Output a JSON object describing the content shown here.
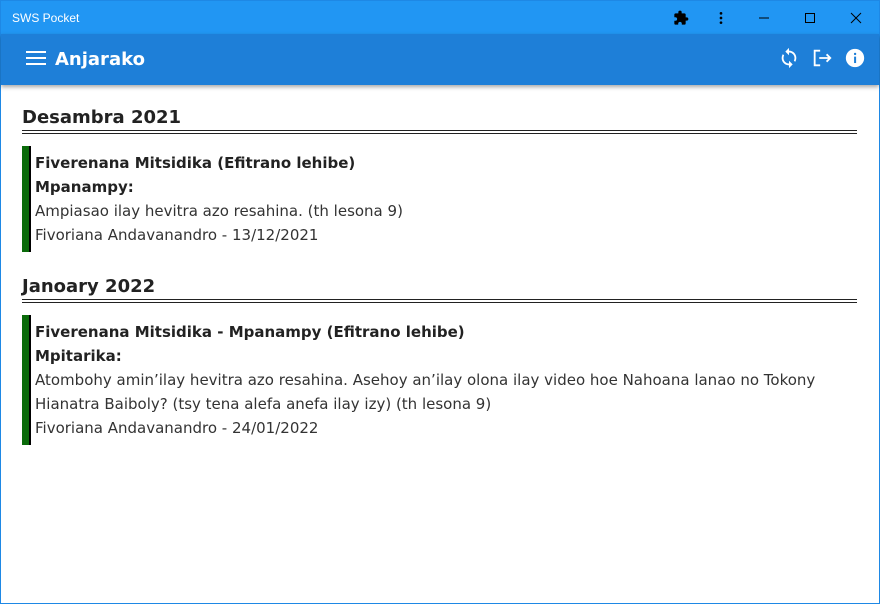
{
  "window": {
    "title": "SWS Pocket",
    "colors": {
      "titlebar": "#2196f3",
      "appbar": "#1e7fd8",
      "accent_border": "#0a6b0a"
    }
  },
  "appbar": {
    "title": "Anjarako",
    "icons": [
      "menu-icon",
      "sync-icon",
      "logout-icon",
      "info-icon"
    ]
  },
  "sections": [
    {
      "month": "Desambra 2021",
      "entries": [
        {
          "title": "Fiverenana Mitsidika (Efitrano lehibe)",
          "role": "Mpanampy:",
          "description": "Ampiasao ilay hevitra azo resahina. (th lesona 9)",
          "meta": "Fivoriana Andavanandro - 13/12/2021"
        }
      ]
    },
    {
      "month": "Janoary 2022",
      "entries": [
        {
          "title": "Fiverenana Mitsidika - Mpanampy (Efitrano lehibe)",
          "role": "Mpitarika:",
          "description": "Atombohy amin’ilay hevitra azo resahina. Asehoy an’ilay olona ilay video hoe Nahoana lanao no Tokony Hianatra Baiboly? (tsy tena alefa anefa ilay izy) (th lesona 9)",
          "meta": "Fivoriana Andavanandro - 24/01/2022"
        }
      ]
    }
  ]
}
